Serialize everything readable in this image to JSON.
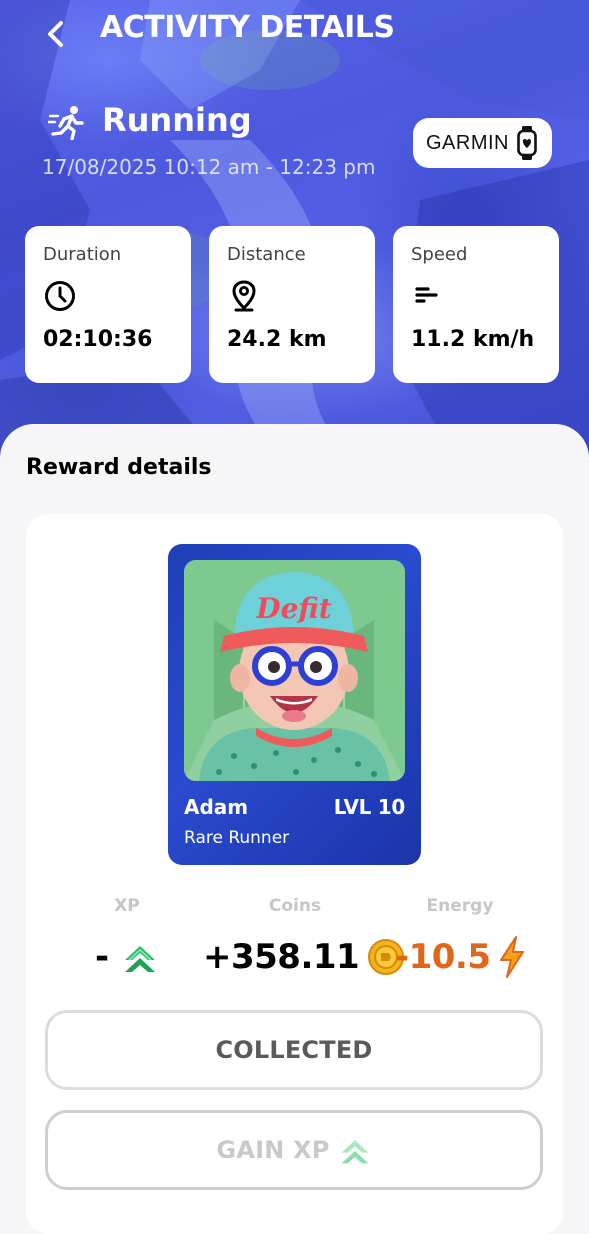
{
  "header": {
    "title": "ACTIVITY DETAILS"
  },
  "activity": {
    "name": "Running",
    "time_range": "17/08/2025 10:12 am - 12:23 pm",
    "device": "GARMIN",
    "icons": {
      "activity": "running-person-icon",
      "device": "smartwatch-icon"
    }
  },
  "stats": [
    {
      "label": "Duration",
      "value": "02:10:36",
      "icon": "clock-icon"
    },
    {
      "label": "Distance",
      "value": "24.2 km",
      "icon": "location-pin-icon"
    },
    {
      "label": "Speed",
      "value": "11.2 km/h",
      "icon": "speed-lines-icon"
    }
  ],
  "rewards": {
    "section_title": "Reward details",
    "nft": {
      "name": "Adam",
      "level": "LVL 10",
      "rarity": "Rare Runner",
      "cap_text": "Defit"
    },
    "xp": {
      "label": "XP",
      "value": "-",
      "icon": "xp-chevron-icon"
    },
    "coins": {
      "label": "Coins",
      "value": "+358.11",
      "icon": "coin-icon"
    },
    "energy": {
      "label": "Energy",
      "value": "-10.5",
      "icon": "lightning-icon"
    },
    "buttons": {
      "collected": "COLLECTED",
      "gain_xp": "GAIN XP"
    }
  },
  "colors": {
    "hero_blue": "#4c58de",
    "energy_orange": "#e0661b",
    "xp_green": "#2fbf6a",
    "coin_gold": "#f2b51d",
    "nft_blue": "#2a4bd0"
  }
}
